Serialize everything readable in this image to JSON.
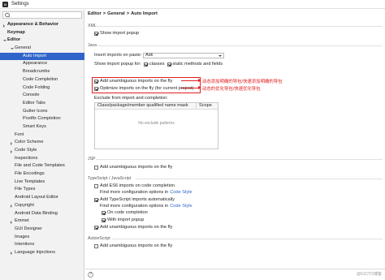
{
  "window": {
    "title": "Settings",
    "icon_text": "IJ"
  },
  "sidebar": {
    "items": [
      {
        "label": "Appearance & Behavior",
        "level": 0,
        "bold": true,
        "caret": "right",
        "selected": false
      },
      {
        "label": "Keymap",
        "level": 0,
        "bold": true,
        "caret": "none",
        "selected": false
      },
      {
        "label": "Editor",
        "level": 0,
        "bold": true,
        "caret": "down",
        "selected": false
      },
      {
        "label": "General",
        "level": 1,
        "bold": false,
        "caret": "down",
        "selected": false
      },
      {
        "label": "Auto Import",
        "level": 2,
        "bold": false,
        "caret": "none",
        "selected": true
      },
      {
        "label": "Appearance",
        "level": 2,
        "bold": false,
        "caret": "none",
        "selected": false
      },
      {
        "label": "Breadcrumbs",
        "level": 2,
        "bold": false,
        "caret": "none",
        "selected": false
      },
      {
        "label": "Code Completion",
        "level": 2,
        "bold": false,
        "caret": "none",
        "selected": false
      },
      {
        "label": "Code Folding",
        "level": 2,
        "bold": false,
        "caret": "none",
        "selected": false
      },
      {
        "label": "Console",
        "level": 2,
        "bold": false,
        "caret": "none",
        "selected": false
      },
      {
        "label": "Editor Tabs",
        "level": 2,
        "bold": false,
        "caret": "none",
        "selected": false
      },
      {
        "label": "Gutter Icons",
        "level": 2,
        "bold": false,
        "caret": "none",
        "selected": false
      },
      {
        "label": "Postfix Completion",
        "level": 2,
        "bold": false,
        "caret": "none",
        "selected": false
      },
      {
        "label": "Smart Keys",
        "level": 2,
        "bold": false,
        "caret": "none",
        "selected": false
      },
      {
        "label": "Font",
        "level": 1,
        "bold": false,
        "caret": "none",
        "selected": false
      },
      {
        "label": "Color Scheme",
        "level": 1,
        "bold": false,
        "caret": "right",
        "selected": false
      },
      {
        "label": "Code Style",
        "level": 1,
        "bold": false,
        "caret": "right",
        "selected": false
      },
      {
        "label": "Inspections",
        "level": 1,
        "bold": false,
        "caret": "none",
        "selected": false
      },
      {
        "label": "File and Code Templates",
        "level": 1,
        "bold": false,
        "caret": "none",
        "selected": false
      },
      {
        "label": "File Encodings",
        "level": 1,
        "bold": false,
        "caret": "none",
        "selected": false
      },
      {
        "label": "Live Templates",
        "level": 1,
        "bold": false,
        "caret": "none",
        "selected": false
      },
      {
        "label": "File Types",
        "level": 1,
        "bold": false,
        "caret": "none",
        "selected": false
      },
      {
        "label": "Android Layout Editor",
        "level": 1,
        "bold": false,
        "caret": "none",
        "selected": false
      },
      {
        "label": "Copyright",
        "level": 1,
        "bold": false,
        "caret": "right",
        "selected": false
      },
      {
        "label": "Android Data Binding",
        "level": 1,
        "bold": false,
        "caret": "none",
        "selected": false
      },
      {
        "label": "Emmet",
        "level": 1,
        "bold": false,
        "caret": "right",
        "selected": false
      },
      {
        "label": "GUI Designer",
        "level": 1,
        "bold": false,
        "caret": "none",
        "selected": false
      },
      {
        "label": "Images",
        "level": 1,
        "bold": false,
        "caret": "none",
        "selected": false
      },
      {
        "label": "Intentions",
        "level": 1,
        "bold": false,
        "caret": "none",
        "selected": false
      },
      {
        "label": "Language Injections",
        "level": 1,
        "bold": false,
        "caret": "right",
        "selected": false
      }
    ]
  },
  "breadcrumb": {
    "part1": "Editor",
    "sep": ">",
    "part2": "General",
    "part3": "Auto Import"
  },
  "xml": {
    "section": "XML",
    "show_import_popup": {
      "label": "Show import popup",
      "checked": true
    }
  },
  "java": {
    "section": "Java",
    "insert_on_paste_label": "Insert imports on paste:",
    "insert_on_paste_value": "Ask",
    "show_popup_for_label": "Show import popup for:",
    "classes": {
      "label": "classes",
      "checked": true
    },
    "static": {
      "label": "static methods and fields",
      "checked": true
    },
    "add_unambiguous": {
      "label": "Add unambiguous imports on the fly",
      "checked": true
    },
    "optimize": {
      "label": "Optimize imports on the fly (for current project)",
      "checked": true
    },
    "annot1": "动态添加明确的导包/快速添加明确的导包",
    "annot2": "动态的优化导包/快速优化导包",
    "exclude_label": "Exclude from import and completion:",
    "table_columns": [
      "Class/package/member qualified name mask",
      "Scope"
    ],
    "table_empty": "No exclude patterns"
  },
  "jsp": {
    "section": "JSP",
    "add_unambiguous": {
      "label": "Add unambiguous imports on the fly",
      "checked": false
    }
  },
  "ts": {
    "section": "TypeScript / JavaScript",
    "es6_completion": {
      "label": "Add ES6 imports on code completion",
      "checked": false
    },
    "more_options_1": "Find more configuration options in",
    "more_options_link_1": "Code Style",
    "ts_auto": {
      "label": "Add TypeScript imports automatically",
      "checked": true
    },
    "more_options_2": "Find more configuration options in",
    "more_options_link_2": "Code Style",
    "on_code_completion": {
      "label": "On code completion",
      "checked": true
    },
    "with_popup": {
      "label": "With import popup",
      "checked": true
    },
    "unambiguous": {
      "label": "Add unambiguous imports on the fly",
      "checked": true
    }
  },
  "actionscript": {
    "section": "ActionScript",
    "add_unambiguous": {
      "label": "Add unambiguous imports on the fly",
      "checked": false
    }
  },
  "footer": {
    "help": "?",
    "watermark": "@51CTO博客"
  },
  "colors": {
    "selection": "#2f65ca",
    "annotation": "#e02020",
    "link": "#2f65ca"
  }
}
